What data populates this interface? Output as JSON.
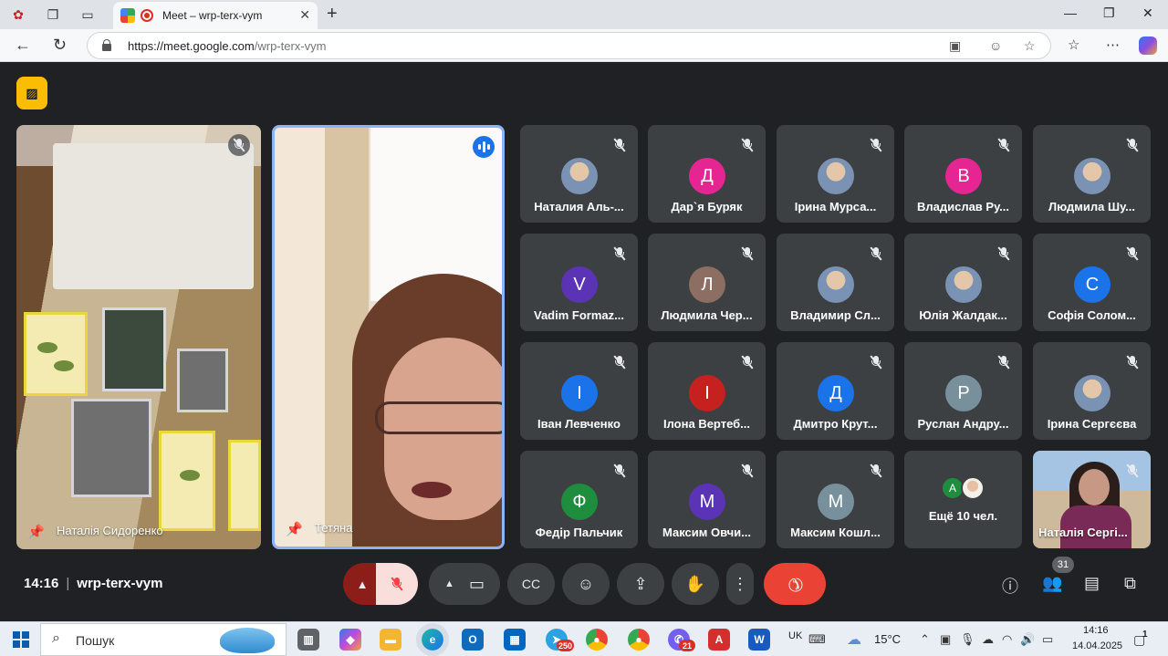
{
  "browser": {
    "tab_title": "Meet – wrp-terx-vym",
    "url_host": "https://meet.google.com",
    "url_path": "/wrp-terx-vym"
  },
  "meet": {
    "time": "14:16",
    "code": "wrp-terx-vym",
    "pinned": [
      {
        "name": "Наталія Сидоренко"
      },
      {
        "name": "Тетяна"
      }
    ],
    "participants": [
      {
        "name": "Наталия Аль-...",
        "avatar": "",
        "color": ""
      },
      {
        "name": "Дар`я Буряк",
        "avatar": "Д",
        "color": "#e52592"
      },
      {
        "name": "Ірина Мурса...",
        "avatar": "",
        "color": ""
      },
      {
        "name": "Владислав Ру...",
        "avatar": "В",
        "color": "#e52592"
      },
      {
        "name": "Людмила Шу...",
        "avatar": "",
        "color": ""
      },
      {
        "name": "Vadim Formaz...",
        "avatar": "V",
        "color": "#5b34b5"
      },
      {
        "name": "Людмила Чер...",
        "avatar": "Л",
        "color": "#8d6e63"
      },
      {
        "name": "Владимир Сл...",
        "avatar": "",
        "color": ""
      },
      {
        "name": "Юлія Жалдак...",
        "avatar": "",
        "color": ""
      },
      {
        "name": "Софія Солом...",
        "avatar": "С",
        "color": "#1a73e8"
      },
      {
        "name": "Іван Левченко",
        "avatar": "І",
        "color": "#1a73e8"
      },
      {
        "name": "Ілона Вертеб...",
        "avatar": "І",
        "color": "#c5221f"
      },
      {
        "name": "Дмитро Крут...",
        "avatar": "Д",
        "color": "#1a73e8"
      },
      {
        "name": "Руслан Андру...",
        "avatar": "Р",
        "color": "#78909c"
      },
      {
        "name": "Ірина Сергєєва",
        "avatar": "",
        "color": ""
      },
      {
        "name": "Федір Пальчик",
        "avatar": "Ф",
        "color": "#1e8e3e"
      },
      {
        "name": "Максим Овчи...",
        "avatar": "М",
        "color": "#5b34b5"
      },
      {
        "name": "Максим Кошл...",
        "avatar": "М",
        "color": "#78909c"
      }
    ],
    "more_label": "Ещё 10 чел.",
    "more_avatar": "А",
    "self_tile_name": "Наталія Сергі...",
    "participant_count": "31"
  },
  "taskbar": {
    "search_placeholder": "Пошук",
    "telegram_badge": "250",
    "viber_badge": "21",
    "lang": "UK",
    "weather": "15°C",
    "clock_time": "14:16",
    "clock_date": "14.04.2025",
    "notif_count": "1"
  }
}
